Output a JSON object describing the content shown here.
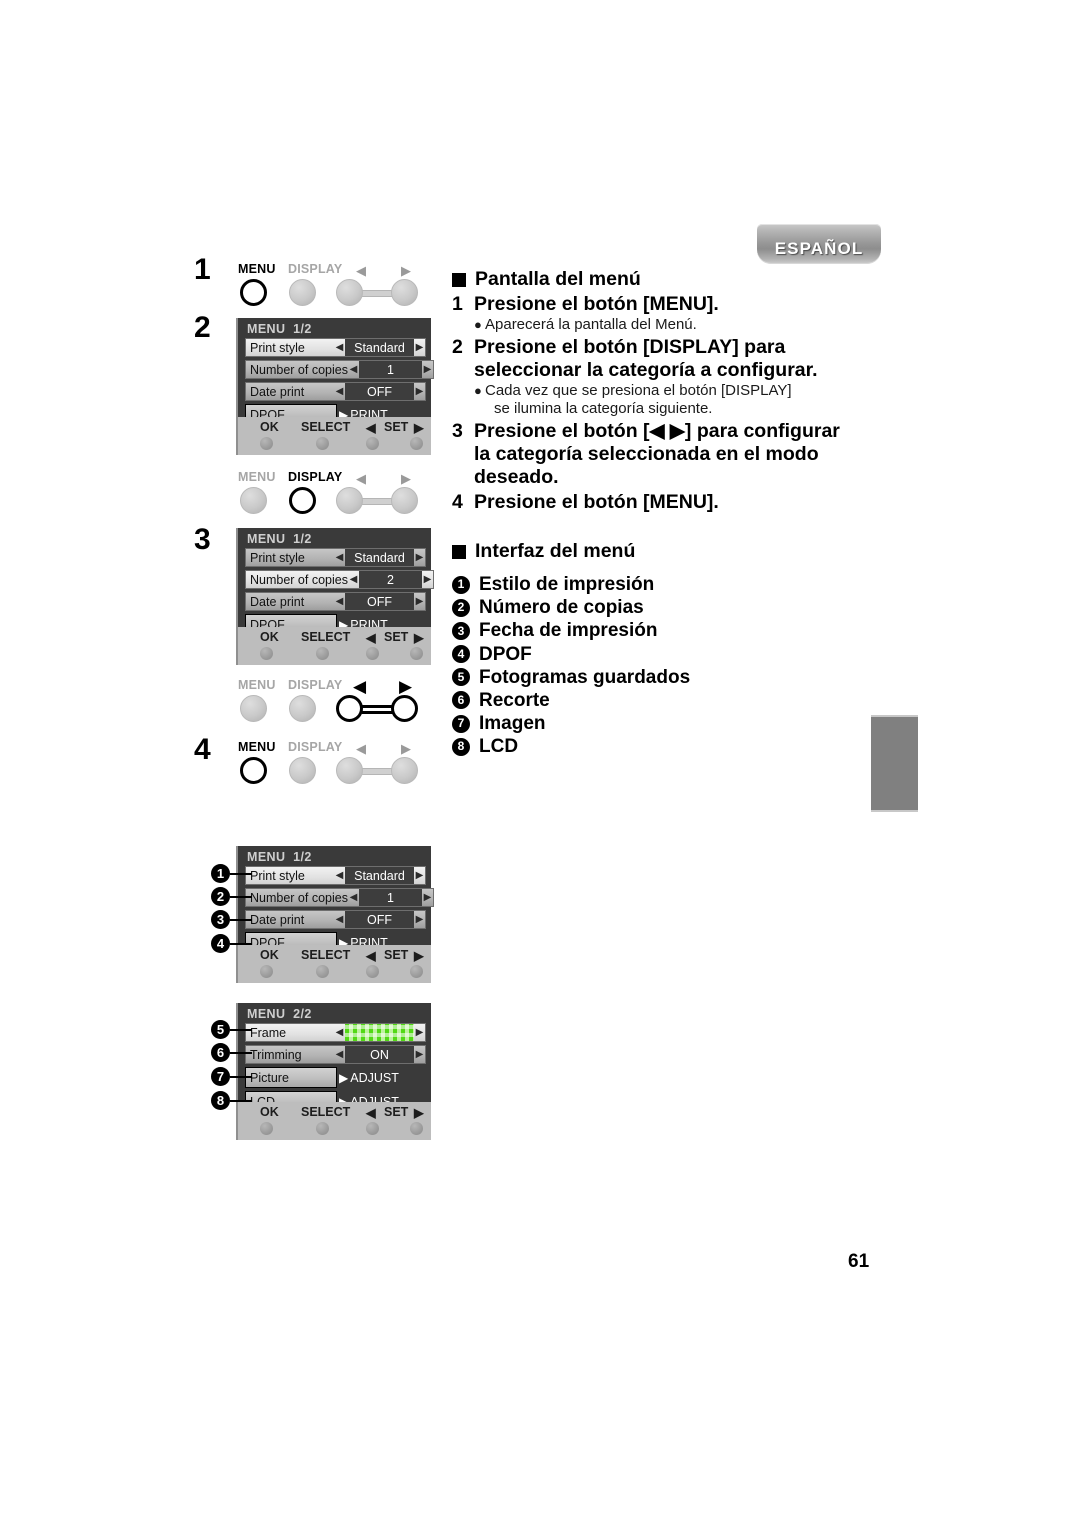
{
  "language_badge": "ESPAÑOL",
  "page_number": "61",
  "left_steps": [
    "1",
    "2",
    "3",
    "4"
  ],
  "buttons": {
    "menu": "MENU",
    "display": "DISPLAY",
    "left_arrow": "◀",
    "right_arrow": "▶"
  },
  "lcd_footer": {
    "ok": "OK",
    "select": "SELECT",
    "left_arrow": "◀",
    "set": "SET",
    "right_arrow": "▶"
  },
  "panels": {
    "menu_1_2": {
      "title": "MENU",
      "page": "1/2",
      "rows": [
        {
          "name": "Print style",
          "value": "Standard",
          "left_arrow": "◀",
          "right_arrow": "▶"
        },
        {
          "name": "Number of copies",
          "value": "1",
          "left_arrow": "◀",
          "right_arrow": "▶"
        },
        {
          "name": "Date print",
          "value": "OFF",
          "left_arrow": "◀",
          "right_arrow": "▶"
        }
      ],
      "action": {
        "name": "DPOF",
        "action": "PRINT",
        "tri": "▶"
      },
      "down_arrow": "▼"
    },
    "menu_1_2_copies2": {
      "title": "MENU",
      "page": "1/2",
      "rows": [
        {
          "name": "Print style",
          "value": "Standard",
          "left_arrow": "◀",
          "right_arrow": "▶"
        },
        {
          "name": "Number of copies",
          "value": "2",
          "left_arrow": "◀",
          "right_arrow": "▶"
        },
        {
          "name": "Date print",
          "value": "OFF",
          "left_arrow": "◀",
          "right_arrow": "▶"
        }
      ],
      "action": {
        "name": "DPOF",
        "action": "PRINT",
        "tri": "▶"
      },
      "down_arrow": "▼"
    },
    "menu_2_2": {
      "title": "MENU",
      "page": "2/2",
      "rows": [
        {
          "name": "Frame",
          "value": "",
          "left_arrow": "◀",
          "right_arrow": "▶"
        },
        {
          "name": "Trimming",
          "value": "ON",
          "left_arrow": "◀",
          "right_arrow": "▶"
        }
      ],
      "actions": [
        {
          "name": "Picture",
          "action": "ADJUST",
          "tri": "▶"
        },
        {
          "name": "LCD",
          "action": "ADJUST",
          "tri": "▶"
        }
      ],
      "down_arrow": "▼"
    }
  },
  "callouts": [
    "1",
    "2",
    "3",
    "4",
    "5",
    "6",
    "7",
    "8"
  ],
  "text": {
    "section1_title": "Pantalla del menú",
    "steps": [
      {
        "num": "1",
        "line1": "Presione el botón [MENU].",
        "line2": "",
        "line3": "",
        "bullets": [
          "Aparecerá la pantalla del Menú."
        ]
      },
      {
        "num": "2",
        "line1": "Presione el botón [DISPLAY] para",
        "line2": "seleccionar la categoría a configurar.",
        "line3": "",
        "bullets": [
          "Cada vez que se presiona el botón [DISPLAY]",
          "se ilumina la categoría siguiente."
        ]
      },
      {
        "num": "3",
        "line1": "Presione el botón [◀ ▶] para configurar",
        "line2": "la categoría seleccionada en el modo",
        "line3": "deseado.",
        "bullets": []
      },
      {
        "num": "4",
        "line1": "Presione el botón [MENU].",
        "line2": "",
        "line3": "",
        "bullets": []
      }
    ],
    "section2_title": "Interfaz del menú",
    "interface_items": [
      {
        "num": "1",
        "label": "Estilo de impresión"
      },
      {
        "num": "2",
        "label": "Número de copias"
      },
      {
        "num": "3",
        "label": "Fecha de impresión"
      },
      {
        "num": "4",
        "label": "DPOF"
      },
      {
        "num": "5",
        "label": "Fotogramas guardados"
      },
      {
        "num": "6",
        "label": "Recorte"
      },
      {
        "num": "7",
        "label": "Imagen"
      },
      {
        "num": "8",
        "label": "LCD"
      }
    ]
  }
}
